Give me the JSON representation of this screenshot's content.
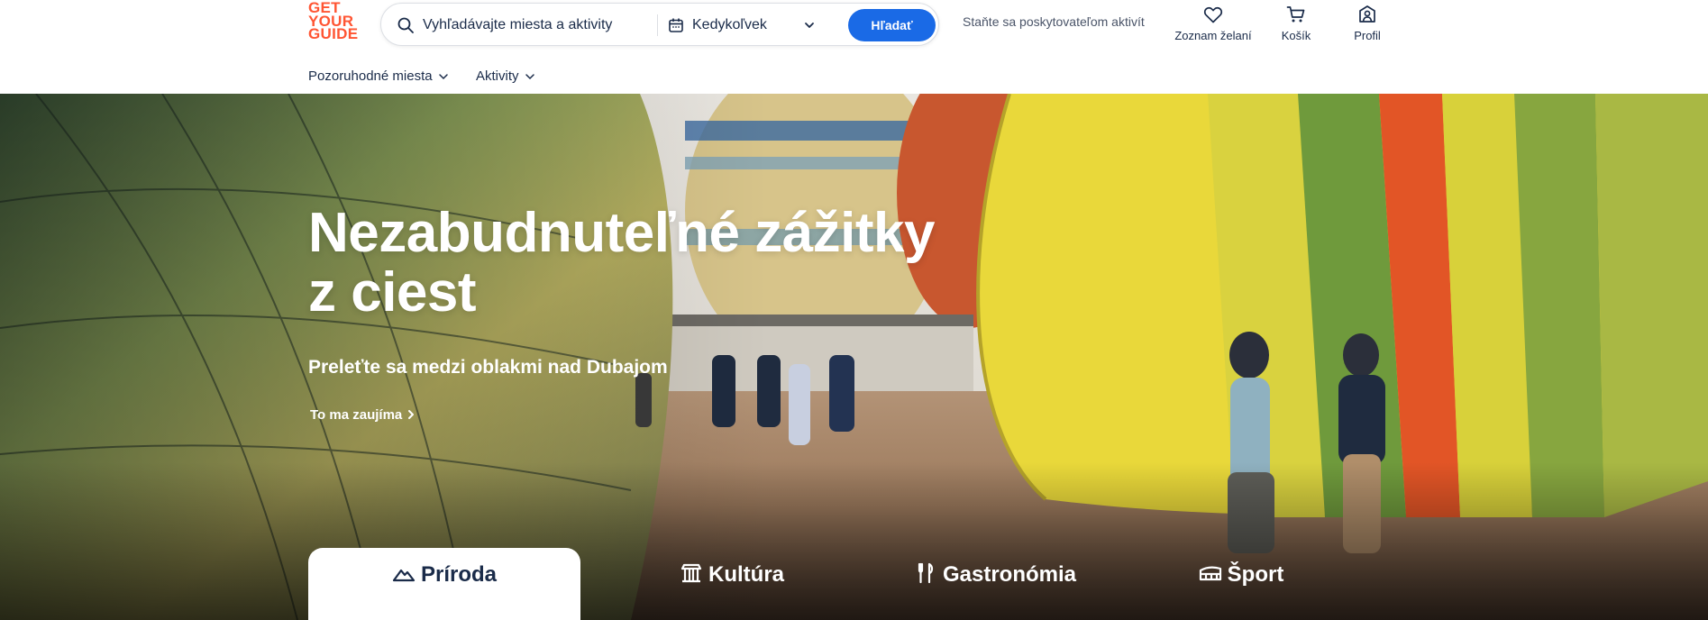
{
  "brand": {
    "logo_lines": [
      "GET",
      "YOUR",
      "GUIDE"
    ],
    "logo_color": "#ff5533"
  },
  "search": {
    "placeholder": "Vyhľadávajte miesta a aktivity",
    "date_label": "Kedykoľvek",
    "button_label": "Hľadať",
    "icon": "search-icon",
    "button_color": "#1a6ae6"
  },
  "header": {
    "supplier_link": "Staňte sa poskytovateľom aktivít",
    "actions": [
      {
        "label": "Zoznam želaní",
        "icon": "heart-icon"
      },
      {
        "label": "Košík",
        "icon": "cart-icon"
      },
      {
        "label": "Profil",
        "icon": "profile-icon"
      }
    ]
  },
  "nav": {
    "items": [
      {
        "label": "Pozoruhodné miesta",
        "icon": "chevron-down-icon"
      },
      {
        "label": "Aktivity",
        "icon": "chevron-down-icon"
      }
    ]
  },
  "hero": {
    "title_lines": [
      "Nezabudnuteľné zážitky",
      "z ciest"
    ],
    "subtitle": "Preleťte sa medzi oblakmi nad Dubajom",
    "cta": "To ma zaujíma",
    "tabs": [
      {
        "label": "Príroda",
        "icon": "mountain-icon",
        "active": true
      },
      {
        "label": "Kultúra",
        "icon": "temple-icon",
        "active": false
      },
      {
        "label": "Gastronómia",
        "icon": "fork-knife-icon",
        "active": false
      },
      {
        "label": "Šport",
        "icon": "stadium-icon",
        "active": false
      }
    ]
  }
}
